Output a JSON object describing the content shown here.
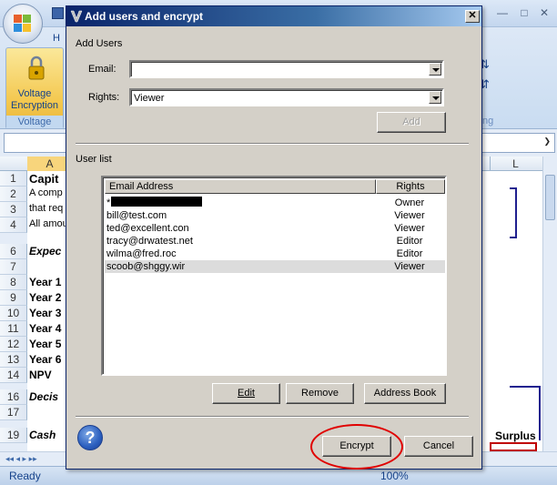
{
  "excel": {
    "ribbon_tab_letter": "H",
    "voltage_button_label": "Voltage Encryption",
    "voltage_group_label": "Voltage",
    "ribbon_partial_label": "ng",
    "col_a": "A",
    "col_l": "L",
    "rows": [
      {
        "num": "1",
        "text": "Capit"
      },
      {
        "num": "2",
        "text": "A comp"
      },
      {
        "num": "3",
        "text": "that req"
      },
      {
        "num": "4",
        "text": "All amou"
      },
      {
        "num": "6",
        "text": "Expec"
      },
      {
        "num": "7",
        "text": ""
      },
      {
        "num": "8",
        "text": "Year 1"
      },
      {
        "num": "9",
        "text": "Year 2"
      },
      {
        "num": "10",
        "text": "Year 3"
      },
      {
        "num": "11",
        "text": "Year 4"
      },
      {
        "num": "12",
        "text": "Year 5"
      },
      {
        "num": "13",
        "text": "Year 6"
      },
      {
        "num": "14",
        "text": "NPV"
      },
      {
        "num": "16",
        "text": "Decis"
      },
      {
        "num": "17",
        "text": ""
      },
      {
        "num": "19",
        "text": "Cash"
      }
    ],
    "surplus_label": "Surplus",
    "status_ready": "Ready",
    "zoom": "100%"
  },
  "dialog": {
    "title": "Add users and encrypt",
    "close_glyph": "✕",
    "add_users_heading": "Add Users",
    "email_label": "Email:",
    "email_value": "",
    "rights_label": "Rights:",
    "rights_value": "Viewer",
    "add_button": "Add",
    "user_list_heading": "User list",
    "columns": {
      "email": "Email Address",
      "rights": "Rights"
    },
    "users": [
      {
        "email": "*",
        "rights": "Owner",
        "redacted": true
      },
      {
        "email": "bill@test.com",
        "rights": "Viewer"
      },
      {
        "email": "ted@excellent.con",
        "rights": "Viewer"
      },
      {
        "email": "tracy@drwatest.net",
        "rights": "Editor"
      },
      {
        "email": "wilma@fred.roc",
        "rights": "Editor"
      },
      {
        "email": "scoob@shggy.wir",
        "rights": "Viewer",
        "selected": true
      }
    ],
    "edit_button": "Edit",
    "remove_button": "Remove",
    "address_book_button": "Address Book",
    "help_glyph": "?",
    "encrypt_button": "Encrypt",
    "cancel_button": "Cancel"
  }
}
